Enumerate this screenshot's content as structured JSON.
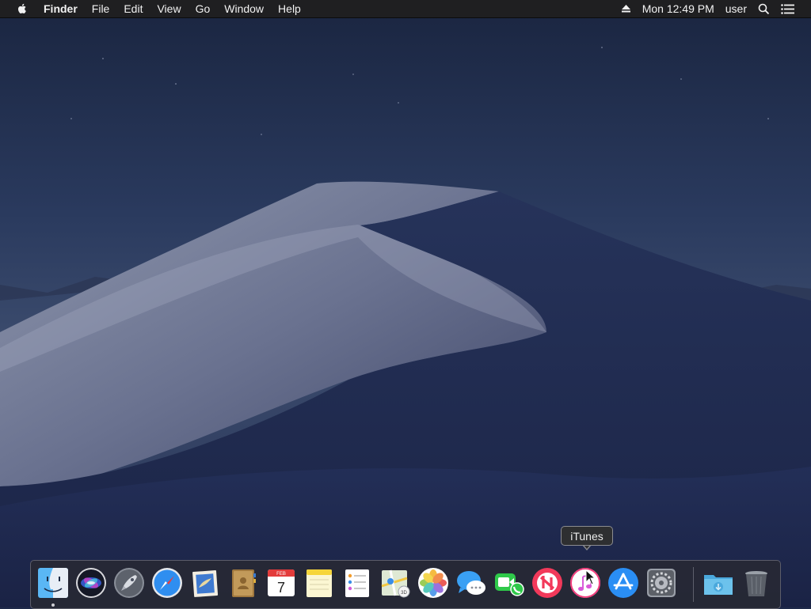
{
  "menubar": {
    "apple_icon": "apple-logo",
    "app_name": "Finder",
    "menus": [
      "File",
      "Edit",
      "View",
      "Go",
      "Window",
      "Help"
    ],
    "status": {
      "eject_icon": "eject-icon",
      "clock": "Mon 12:49 PM",
      "user": "user",
      "search_icon": "spotlight-search-icon",
      "notification_icon": "notification-center-icon"
    }
  },
  "tooltip": {
    "text": "iTunes"
  },
  "dock": {
    "apps": [
      {
        "name": "Finder",
        "icon": "finder-icon",
        "running": true
      },
      {
        "name": "Siri",
        "icon": "siri-icon"
      },
      {
        "name": "Launchpad",
        "icon": "launchpad-icon"
      },
      {
        "name": "Safari",
        "icon": "safari-icon"
      },
      {
        "name": "Mail",
        "icon": "mail-icon"
      },
      {
        "name": "Contacts",
        "icon": "contacts-icon"
      },
      {
        "name": "Calendar",
        "icon": "calendar-icon",
        "month": "FEB",
        "day": "7"
      },
      {
        "name": "Notes",
        "icon": "notes-icon"
      },
      {
        "name": "Reminders",
        "icon": "reminders-icon"
      },
      {
        "name": "Maps",
        "icon": "maps-icon"
      },
      {
        "name": "Photos",
        "icon": "photos-icon"
      },
      {
        "name": "Messages",
        "icon": "messages-icon"
      },
      {
        "name": "FaceTime",
        "icon": "facetime-icon"
      },
      {
        "name": "News",
        "icon": "news-icon"
      },
      {
        "name": "iTunes",
        "icon": "itunes-icon"
      },
      {
        "name": "App Store",
        "icon": "app-store-icon"
      },
      {
        "name": "System Preferences",
        "icon": "system-preferences-icon"
      },
      {
        "name": "Downloads",
        "icon": "downloads-folder-icon"
      },
      {
        "name": "Trash",
        "icon": "trash-icon"
      }
    ]
  }
}
